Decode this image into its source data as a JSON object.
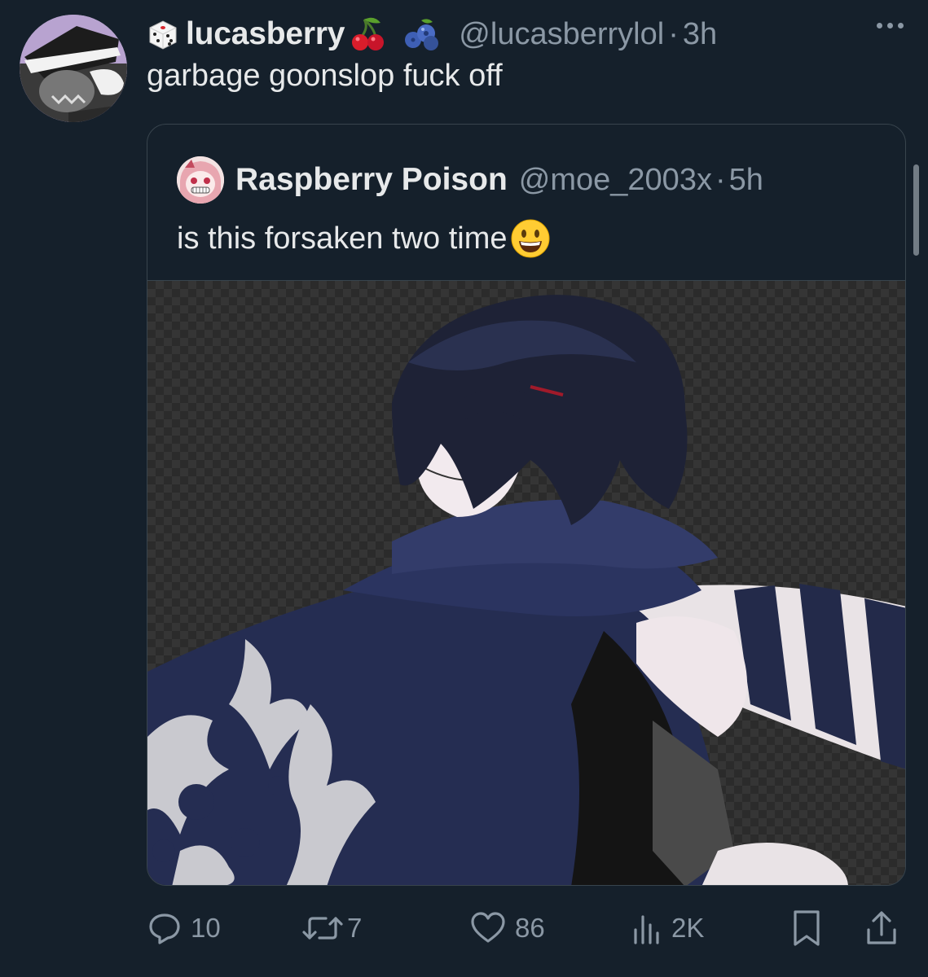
{
  "tweet": {
    "author": {
      "name": "lucasberry",
      "handle": "@lucasberrylol",
      "name_emojis": [
        "dice-icon",
        "cherry-icon",
        "blueberry-icon"
      ]
    },
    "time": "3h",
    "separator": "·",
    "text": "garbage goonslop fuck off"
  },
  "quote": {
    "author": {
      "name": "Raspberry Poison",
      "handle": "@moe_2003x"
    },
    "separator": "·",
    "time": "5h",
    "text": "is this forsaken two time",
    "text_emoji": "grinning-face-icon"
  },
  "actions": {
    "replies": "10",
    "reposts": "7",
    "likes": "86",
    "views": "2K"
  },
  "colors": {
    "background": "#15202b",
    "primary_text": "#e7e9ea",
    "secondary_text": "#8b98a5",
    "border": "#38444d"
  }
}
